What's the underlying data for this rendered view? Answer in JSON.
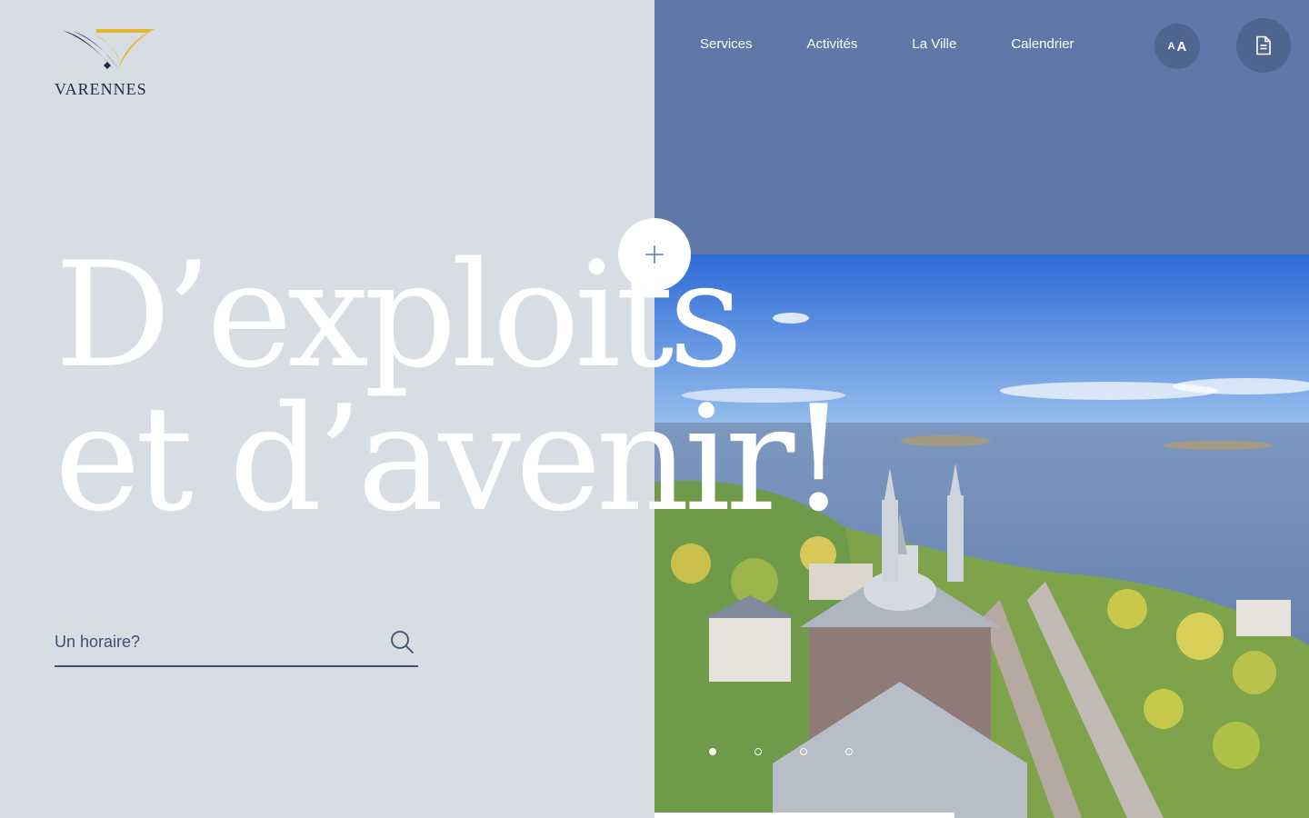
{
  "brand": {
    "name": "VARENNES"
  },
  "nav": {
    "items": [
      {
        "label": "Services"
      },
      {
        "label": "Activités"
      },
      {
        "label": "La Ville"
      },
      {
        "label": "Calendrier"
      }
    ],
    "text_size_button": {
      "small": "A",
      "big": "A"
    }
  },
  "hero": {
    "headline_line1": "D’exploits",
    "headline_line2": "et d’avenir!"
  },
  "search": {
    "placeholder": "Un horaire?",
    "value": ""
  },
  "slider": {
    "count": 4,
    "active_index": 0
  },
  "icons": {
    "logo": "varennes-logo-icon",
    "text_size": "text-size-icon",
    "document": "document-icon",
    "plus": "plus-icon",
    "search": "search-icon"
  },
  "colors": {
    "left_bg": "#d8dde3",
    "top_band": "#5f78a8",
    "button_bg": "#4f6590",
    "dark_blue": "#1b2a4a",
    "accent_gold": "#e5b52d"
  }
}
